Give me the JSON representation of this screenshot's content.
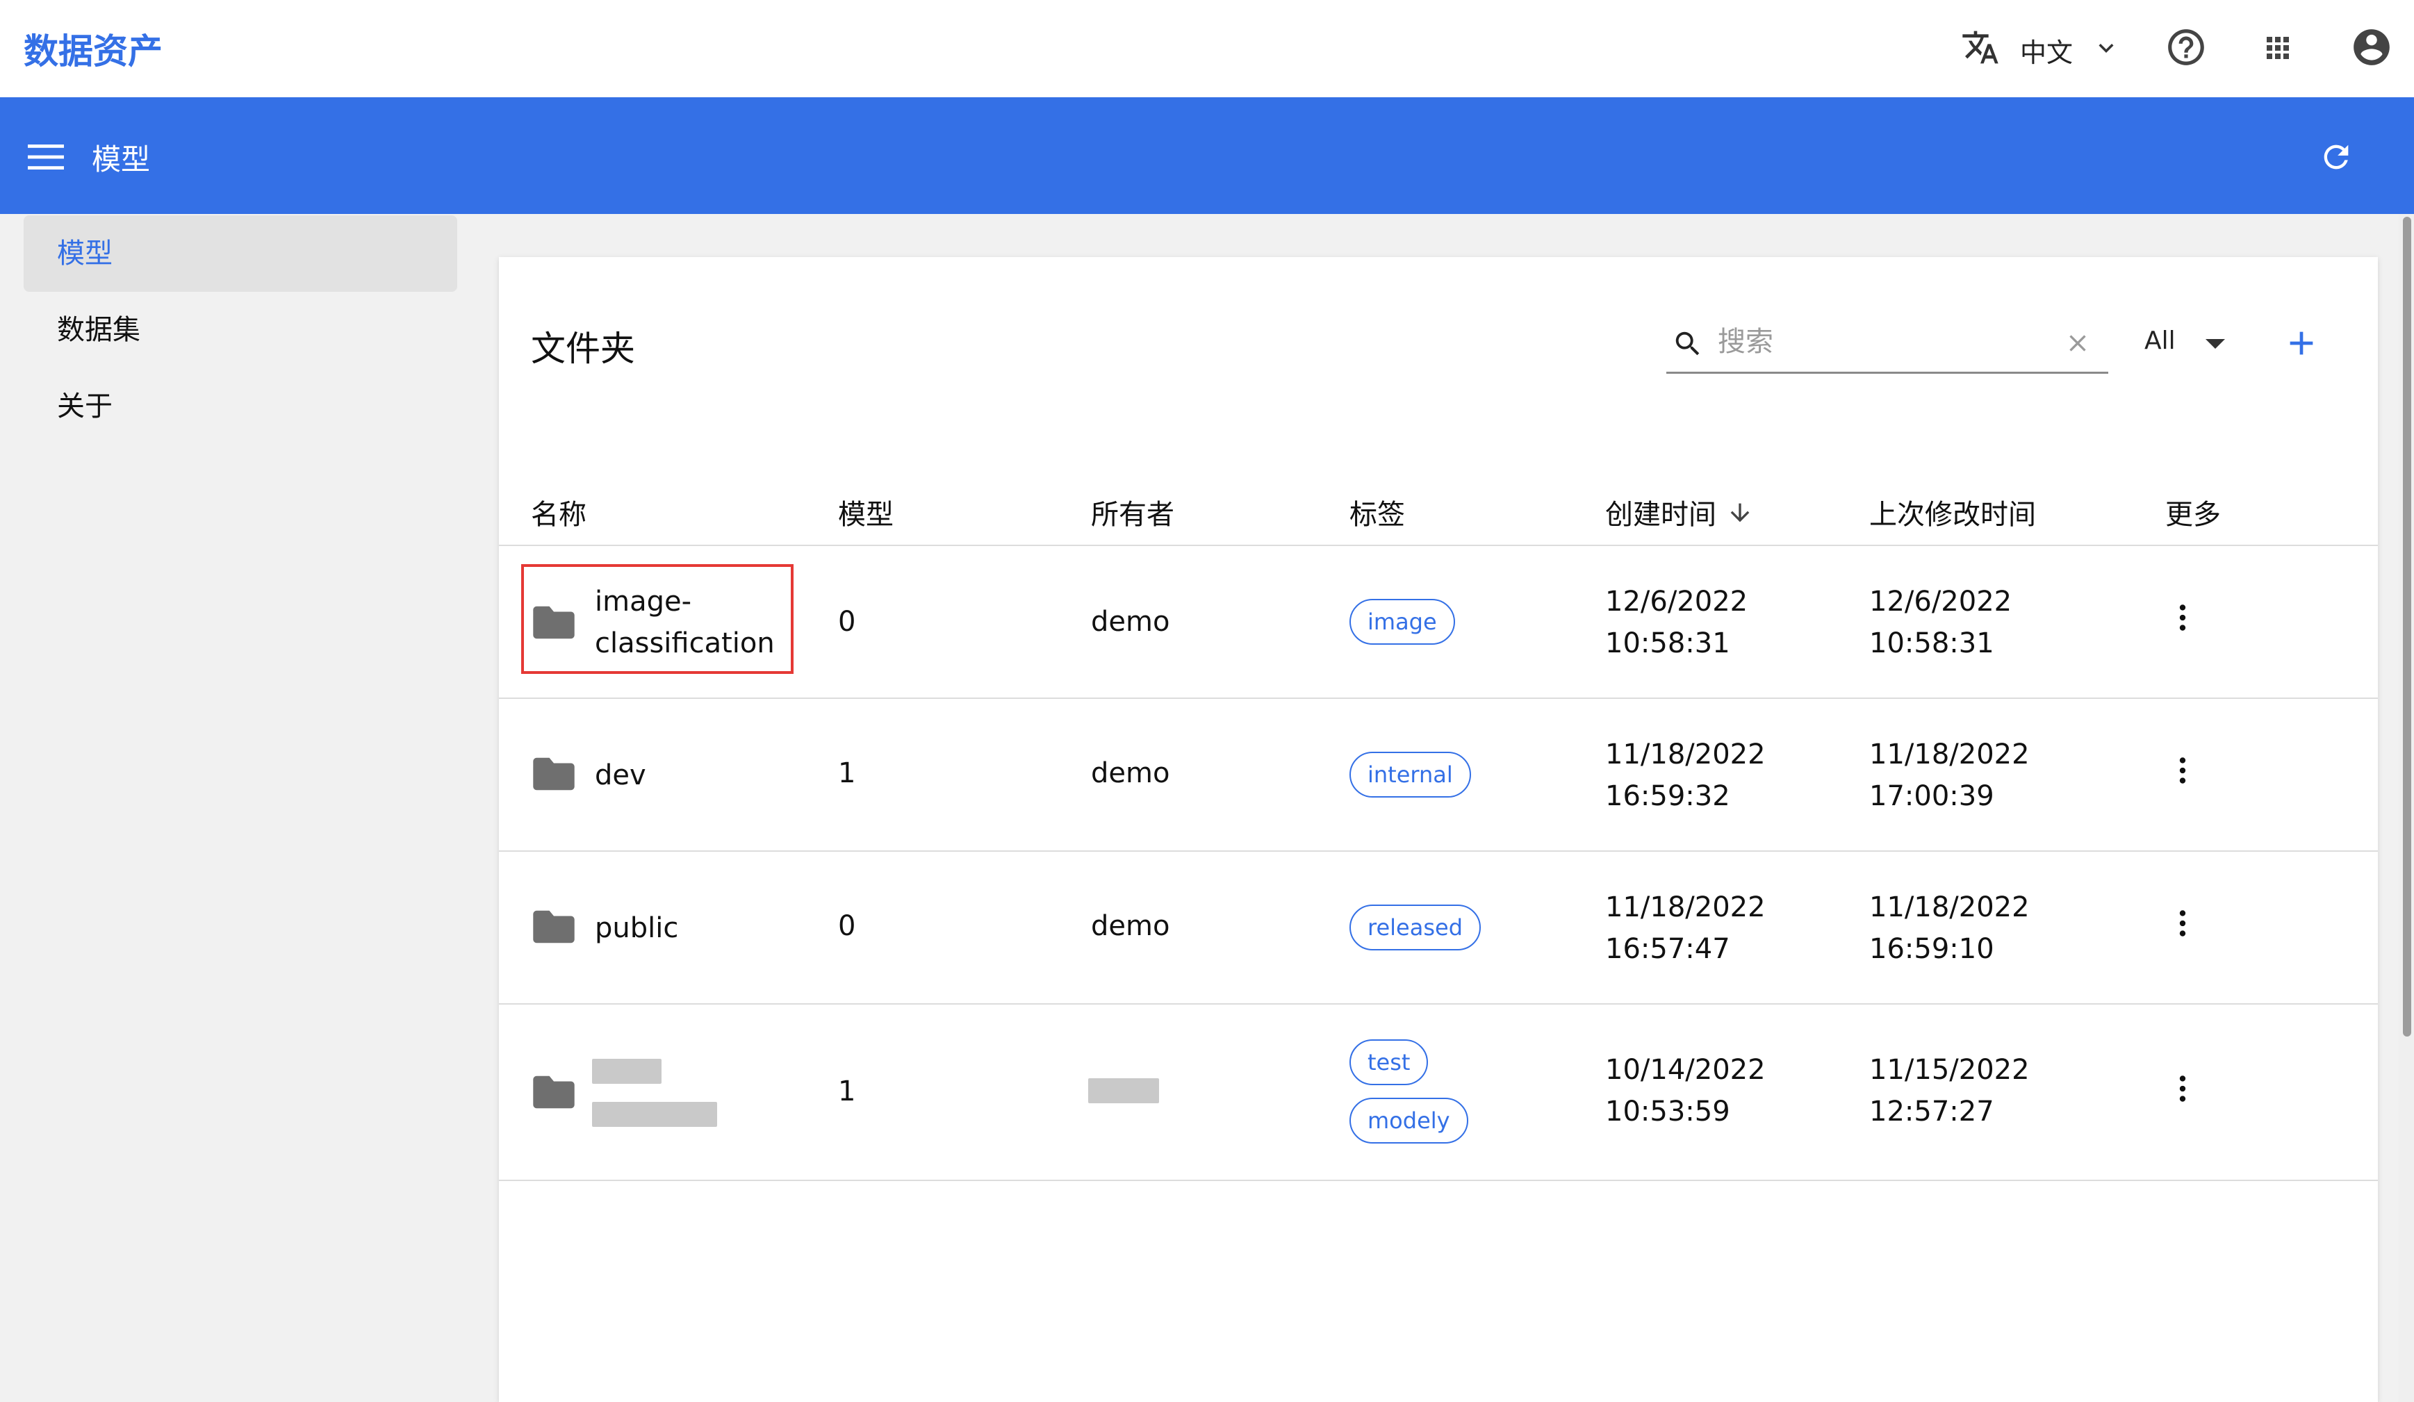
{
  "app": {
    "brand": "数据资产",
    "language_label": "中文",
    "icons": {
      "language": "translate-icon",
      "language_dropdown": "chevron-down-icon",
      "help": "help-circle-icon",
      "apps": "apps-grid-icon",
      "account": "account-circle-icon"
    }
  },
  "toolbar": {
    "title": "模型",
    "icons": {
      "menu": "menu-icon",
      "refresh": "refresh-icon"
    },
    "color": "#3470e6"
  },
  "sidebar": {
    "items": [
      {
        "label": "模型",
        "active": true
      },
      {
        "label": "数据集",
        "active": false
      },
      {
        "label": "关于",
        "active": false
      }
    ]
  },
  "folders": {
    "title": "文件夹",
    "search": {
      "placeholder": "搜索",
      "value": ""
    },
    "filter": {
      "selected": "All"
    },
    "columns": [
      "名称",
      "模型",
      "所有者",
      "标签",
      "创建时间",
      "上次修改时间",
      "更多"
    ],
    "rows": [
      {
        "name_lines": [
          "image-",
          "classification"
        ],
        "models": "0",
        "owner": "demo",
        "tags": [
          "image"
        ],
        "created": [
          "12/6/2022",
          "10:58:31"
        ],
        "modified": [
          "12/6/2022",
          "10:58:31"
        ],
        "highlighted": true
      },
      {
        "name_lines": [
          "dev"
        ],
        "models": "1",
        "owner": "demo",
        "tags": [
          "internal"
        ],
        "created": [
          "11/18/2022",
          "16:59:32"
        ],
        "modified": [
          "11/18/2022",
          "17:00:39"
        ]
      },
      {
        "name_lines": [
          "public"
        ],
        "models": "0",
        "owner": "demo",
        "tags": [
          "released"
        ],
        "created": [
          "11/18/2022",
          "16:57:47"
        ],
        "modified": [
          "11/18/2022",
          "16:59:10"
        ]
      },
      {
        "name_lines": [],
        "name_redacted": true,
        "models": "1",
        "owner": "",
        "owner_redacted": true,
        "tags": [
          "test",
          "modely"
        ],
        "created": [
          "10/14/2022",
          "10:53:59"
        ],
        "modified": [
          "11/15/2022",
          "12:57:27"
        ]
      }
    ]
  }
}
